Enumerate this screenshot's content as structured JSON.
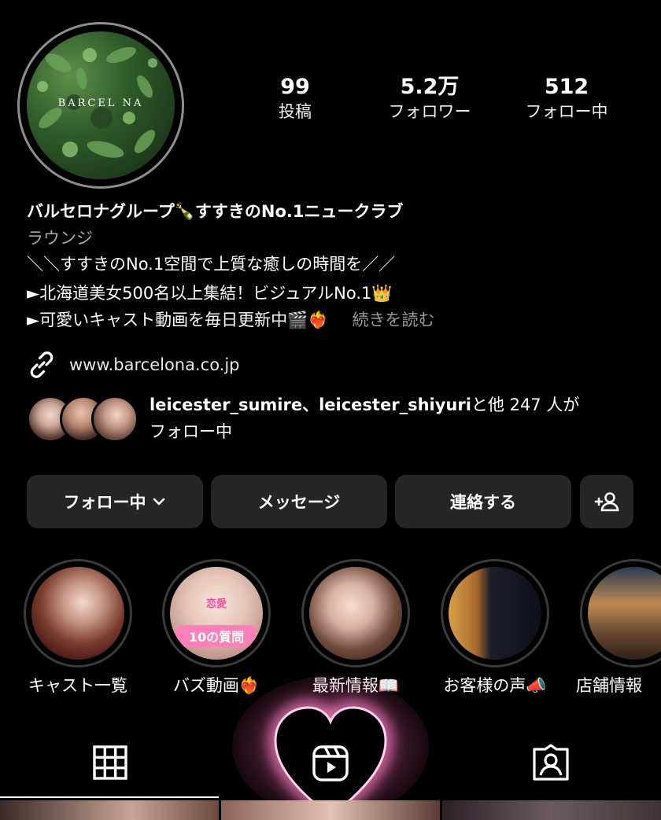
{
  "profile": {
    "avatar_text": "BARCEL  NA",
    "stats": [
      {
        "value": "99",
        "label": "投稿"
      },
      {
        "value": "5.2万",
        "label": "フォロワー"
      },
      {
        "value": "512",
        "label": "フォロー中"
      }
    ],
    "name": "バルセロナグループ🍾すすきのNo.1ニュークラブ",
    "category": "ラウンジ",
    "bio_lines": [
      "＼＼すすきのNo.1空間で上質な癒しの時間を／／",
      "►北海道美女500名以上集結！ビジュアルNo.1👑",
      "►可愛いキャスト動画を毎日更新中🎬❤️‍🔥"
    ],
    "more_label": "続きを読む",
    "link": "www.barcelona.co.jp",
    "followed_by": {
      "names": "leicester_sumire、leicester_shiyuri",
      "rest": "と他 247 人が",
      "line2": "フォロー中"
    }
  },
  "actions": {
    "following": "フォロー中",
    "message": "メッセージ",
    "contact": "連絡する"
  },
  "highlights": [
    {
      "label": "キャスト一覧"
    },
    {
      "label": "バズ動画❤️‍🔥",
      "inner_text_top": "恋愛",
      "inner_text_bottom": "10の質問"
    },
    {
      "label": "最新情報📖"
    },
    {
      "label": "お客様の声📣"
    },
    {
      "label": "店舗情報"
    }
  ],
  "icons": {
    "link": "link-icon",
    "chevron": "chevron-down-icon",
    "add_person": "add-person-icon",
    "grid": "grid-icon",
    "reels": "reels-icon",
    "tagged": "tagged-icon"
  }
}
